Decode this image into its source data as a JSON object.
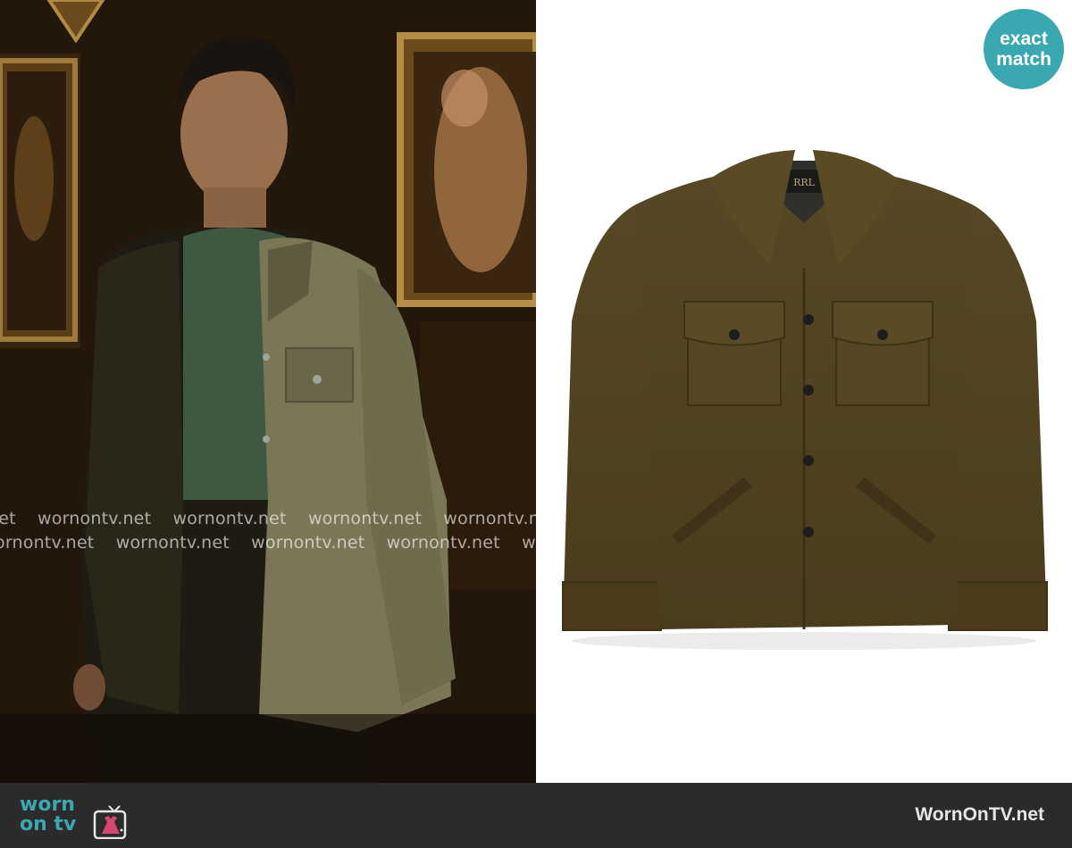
{
  "badge": {
    "line1": "exact",
    "line2": "match"
  },
  "watermark": {
    "text": "wornontv.net",
    "row1": [
      "net",
      "wornontv.net",
      "wornontv.net",
      "wornontv.net",
      "wornontv.net"
    ],
    "row2": [
      "ornontv.net",
      "wornontv.net",
      "wornontv.net",
      "wornontv.net",
      "wo"
    ]
  },
  "footer": {
    "logo_word1": "worn",
    "logo_word2": "on tv",
    "site_name": "WornOnTV.net"
  },
  "icons": {
    "tv": "dress-tv-icon"
  },
  "colors": {
    "accent": "#3aa8b1",
    "footer_bg": "#2b2b2b",
    "jacket": "#4e4120"
  }
}
